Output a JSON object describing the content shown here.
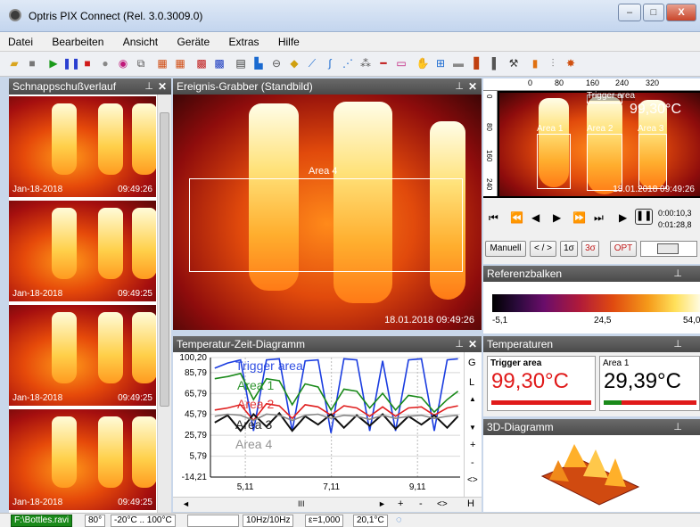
{
  "window": {
    "title": "Optris PIX Connect (Rel. 3.0.3009.0)",
    "minimize": "–",
    "maximize": "□",
    "close": "X"
  },
  "menu": [
    "Datei",
    "Bearbeiten",
    "Ansicht",
    "Geräte",
    "Extras",
    "Hilfe"
  ],
  "snapshot_panel": {
    "title": "Schnappschußverlauf",
    "thumbs": [
      {
        "date": "Jan-18-2018",
        "time": "09:49:26"
      },
      {
        "date": "Jan-18-2018",
        "time": "09:49:25"
      },
      {
        "date": "Jan-18-2018",
        "time": "09:49:25"
      },
      {
        "date": "Jan-18-2018",
        "time": "09:49:25"
      }
    ]
  },
  "grabber": {
    "title": "Ereignis-Grabber (Standbild)",
    "area_label": "Area 4",
    "timestamp": "18.01.2018 09:49:26"
  },
  "live": {
    "ruler": [
      "0",
      "80",
      "160",
      "240",
      "320"
    ],
    "vruler": [
      "0",
      "80",
      "160",
      "240"
    ],
    "trigger_label": "Trigger area",
    "trigger_value": "99,30°C",
    "areas": [
      "Area 1",
      "Area 2",
      "Area 3"
    ],
    "timestamp": "18.01.2018 09:49:26",
    "time1": "0:00:10,3",
    "time2": "0:01:28,8"
  },
  "controls": {
    "manual": "Manuell",
    "lr": "< / >",
    "one_sigma": "1σ",
    "three_sigma": "3σ",
    "opt": "OPT"
  },
  "refbar": {
    "title": "Referenzbalken",
    "min": "-5,1",
    "mid": "24,5",
    "max": "54,0"
  },
  "temps": {
    "title": "Temperaturen",
    "t1_label": "Trigger area",
    "t1_value": "99,30°C",
    "t2_label": "Area 1",
    "t2_value": "29,39°C"
  },
  "diagram3d": {
    "title": "3D-Diagramm"
  },
  "chart": {
    "title": "Temperatur-Zeit-Diagramm",
    "yticks": [
      "100,20",
      "85,79",
      "65,79",
      "45,79",
      "25,79",
      "5,79",
      "-14,21"
    ],
    "xticks": [
      "5,11",
      "7,11",
      "9,11"
    ],
    "legend": [
      "Trigger area",
      "Area 1",
      "Area 2",
      "Area 3",
      "Area 4"
    ],
    "side": [
      "G",
      "L",
      "▲",
      "▼",
      "+",
      "-",
      "<>"
    ],
    "bottom": [
      "◄",
      "III",
      "►",
      "+",
      "-",
      "<>",
      "H"
    ],
    "colors": {
      "trigger": "#1b3de0",
      "area1": "#1a8a1a",
      "area2": "#e02020",
      "area3": "#111111",
      "area4": "#888888"
    }
  },
  "chart_data": {
    "type": "line",
    "title": "Temperatur-Zeit-Diagramm",
    "xlabel": "",
    "ylabel": "",
    "xlim": [
      4.3,
      10.1
    ],
    "ylim": [
      -14.21,
      100.2
    ],
    "x": [
      4.4,
      4.7,
      5.0,
      5.3,
      5.6,
      5.9,
      6.2,
      6.5,
      6.8,
      7.1,
      7.4,
      7.7,
      8.0,
      8.3,
      8.6,
      8.9,
      9.2,
      9.5,
      9.8,
      10.05
    ],
    "series": [
      {
        "name": "Trigger area",
        "values": [
          90,
          95,
          98,
          30,
          98,
          99,
          30,
          97,
          98,
          28,
          99,
          98,
          30,
          97,
          30,
          98,
          99,
          30,
          98,
          99
        ]
      },
      {
        "name": "Area 1",
        "values": [
          80,
          82,
          85,
          60,
          80,
          78,
          55,
          75,
          72,
          50,
          70,
          68,
          52,
          66,
          50,
          64,
          62,
          48,
          60,
          68
        ]
      },
      {
        "name": "Area 2",
        "values": [
          50,
          52,
          55,
          40,
          56,
          54,
          42,
          55,
          53,
          45,
          54,
          52,
          44,
          53,
          44,
          52,
          53,
          45,
          52,
          54
        ]
      },
      {
        "name": "Area 3",
        "values": [
          38,
          45,
          30,
          46,
          34,
          47,
          30,
          44,
          36,
          46,
          33,
          45,
          35,
          46,
          32,
          44,
          36,
          45,
          33,
          44
        ]
      },
      {
        "name": "Area 4",
        "values": [
          44,
          46,
          45,
          40,
          46,
          45,
          40,
          45,
          46,
          42,
          45,
          44,
          41,
          45,
          42,
          44,
          45,
          42,
          44,
          45
        ]
      }
    ]
  },
  "status": {
    "file": "F:\\Bottles.ravi",
    "fov": "80°",
    "range": "-20°C .. 100°C",
    "rate": "10Hz/10Hz",
    "eps": "ε=1,000",
    "ambient": "20,1°C"
  }
}
